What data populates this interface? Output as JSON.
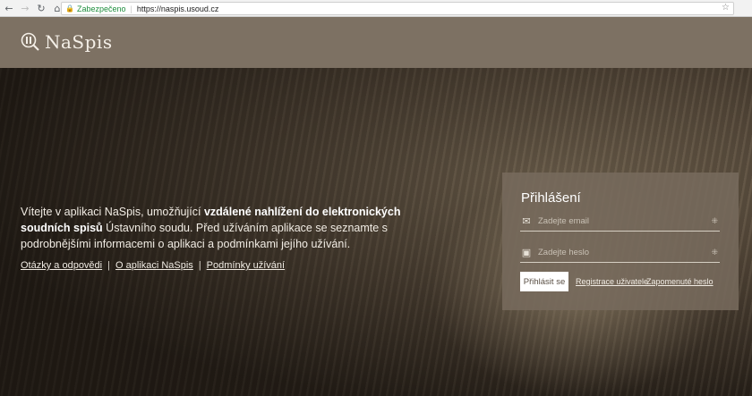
{
  "browser": {
    "secure_label": "Zabezpečeno",
    "url": "https://naspis.usoud.cz",
    "back_icon": "arrow-left-icon",
    "forward_icon": "arrow-right-icon",
    "reload_icon": "reload-icon",
    "home_icon": "home-icon",
    "bookmark_icon": "star-icon"
  },
  "header": {
    "logo_text": "NaSpis",
    "color": "#7d7163"
  },
  "intro": {
    "text_before": "Vítejte v aplikaci NaSpis, umožňující ",
    "bold": "vzdálené nahlížení do elektronických soudních spisů",
    "text_after": " Ústavního soudu. Před užíváním aplikace se seznamte s podrobnějšími informacemi o aplikaci a podmínkami jejího užívání."
  },
  "links": [
    {
      "label": "Otázky a odpovědi"
    },
    {
      "label": "O aplikaci NaSpis"
    },
    {
      "label": "Podmínky užívání"
    }
  ],
  "login": {
    "title": "Přihlášení",
    "email_placeholder": "Zadejte email",
    "password_placeholder": "Zadejte heslo",
    "submit_label": "Přihlásit se",
    "register_label": "Registrace uživatele",
    "forgot_label": "Zapomenuté heslo"
  }
}
